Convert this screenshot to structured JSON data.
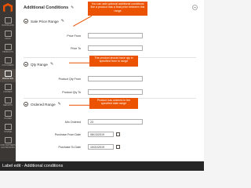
{
  "sidebar": {
    "items": [
      {
        "label": "DASHBOARD"
      },
      {
        "label": "SALES"
      },
      {
        "label": "PRODUCTS"
      },
      {
        "label": "CUSTOMERS"
      },
      {
        "label": "MARKETING"
      },
      {
        "label": "CONTENT"
      },
      {
        "label": "REPORTS"
      },
      {
        "label": "STORES"
      },
      {
        "label": "SYSTEM"
      },
      {
        "label": "FIND PARTNERS & EXTENSIONS"
      }
    ],
    "active_index": 4
  },
  "panel": {
    "title": "Additional Conditions",
    "sections": {
      "sale_price": {
        "title": "Sale Price Range",
        "price_from_label": "Price From",
        "price_to_label": "Price To",
        "price_from_value": "",
        "price_to_value": ""
      },
      "qty": {
        "title": "Qty Range",
        "qty_from_label": "Product Qty From",
        "qty_to_label": "Product Qty To",
        "qty_from_value": "",
        "qty_to_value": ""
      },
      "ordered": {
        "title": "Ordered Range",
        "min_ordered_label": "Min Ordered",
        "min_ordered_value": "23",
        "purchase_from_label": "Purchase From Date",
        "purchase_from_value": "08/13/2019",
        "purchase_to_label": "Purchase To Date",
        "purchase_to_value": "10/31/2019"
      }
    }
  },
  "tooltips": {
    "sale_price": "You can add optional additional conditions like a product has a final price between this range",
    "qty": "The product should have qty in specified from to range",
    "ordered": "Product has ordered in the specified date range"
  },
  "caption": "Label edit - Additional conditions",
  "colors": {
    "accent": "#eb5202",
    "sidebar": "#3b3734",
    "caption_bar": "#262626"
  }
}
